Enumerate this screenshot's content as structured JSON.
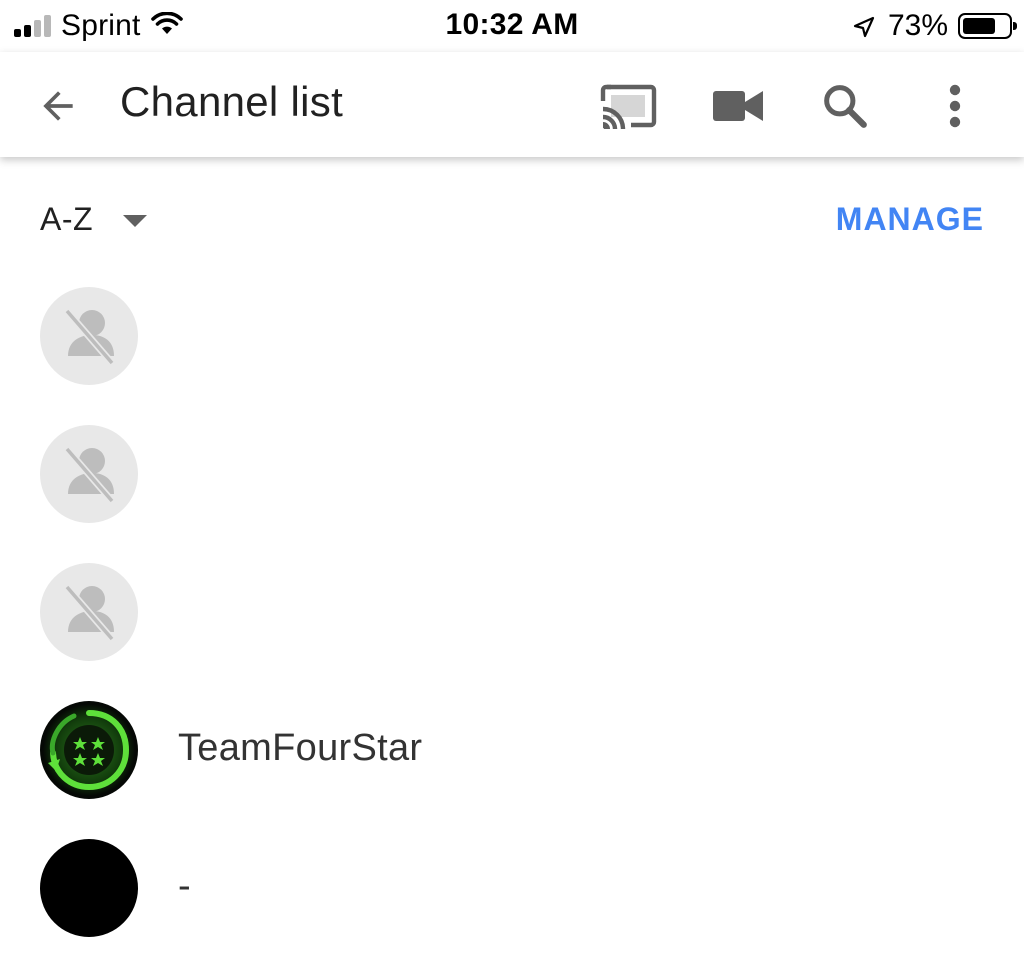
{
  "status_bar": {
    "carrier": "Sprint",
    "time": "10:32 AM",
    "battery_percent": "73%",
    "battery_level": 0.73,
    "signal_bars_filled": 2,
    "signal_bars_total": 4
  },
  "app_bar": {
    "title": "Channel list",
    "icons": [
      "back-arrow-icon",
      "cast-icon",
      "video-camera-icon",
      "search-icon",
      "more-vert-icon"
    ]
  },
  "sort": {
    "label": "A-Z",
    "manage_label": "MANAGE"
  },
  "channels": [
    {
      "name": "",
      "avatar": "placeholder"
    },
    {
      "name": "",
      "avatar": "placeholder"
    },
    {
      "name": "",
      "avatar": "placeholder"
    },
    {
      "name": "TeamFourStar",
      "avatar": "teamfourstar-logo"
    },
    {
      "name": "-",
      "avatar": "black"
    }
  ],
  "colors": {
    "accent": "#4285f4",
    "icon_gray": "#606060",
    "placeholder_bg": "#e8e8e8",
    "placeholder_icon": "#bdbdbd",
    "logo_green": "#39b54a"
  }
}
